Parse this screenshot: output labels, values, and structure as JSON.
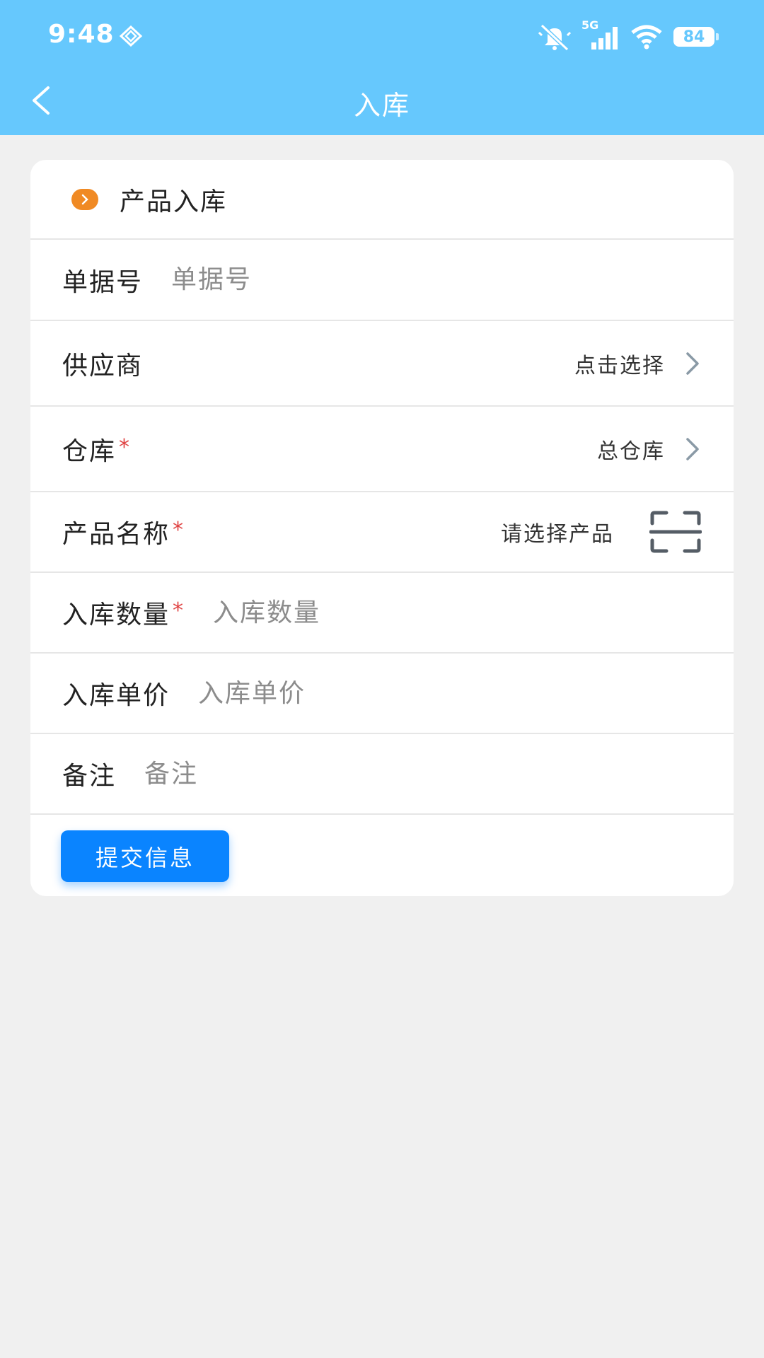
{
  "status": {
    "time": "9:48",
    "network": "5G",
    "battery": "84"
  },
  "nav": {
    "title": "入库"
  },
  "section": {
    "title": "产品入库"
  },
  "form": {
    "doc_no": {
      "label": "单据号",
      "placeholder": "单据号"
    },
    "supplier": {
      "label": "供应商",
      "value": "点击选择"
    },
    "warehouse": {
      "label": "仓库",
      "required_mark": "*",
      "value": "总仓库"
    },
    "product": {
      "label": "产品名称",
      "required_mark": "*",
      "value": "请选择产品"
    },
    "quantity": {
      "label": "入库数量",
      "required_mark": "*",
      "placeholder": "入库数量"
    },
    "unit_price": {
      "label": "入库单价",
      "placeholder": "入库单价"
    },
    "remark": {
      "label": "备注",
      "placeholder": "备注"
    }
  },
  "submit": {
    "label": "提交信息"
  },
  "colors": {
    "header": "#66c8fd",
    "accent": "#0a84ff",
    "orange": "#f08a24",
    "required": "#e04444"
  }
}
